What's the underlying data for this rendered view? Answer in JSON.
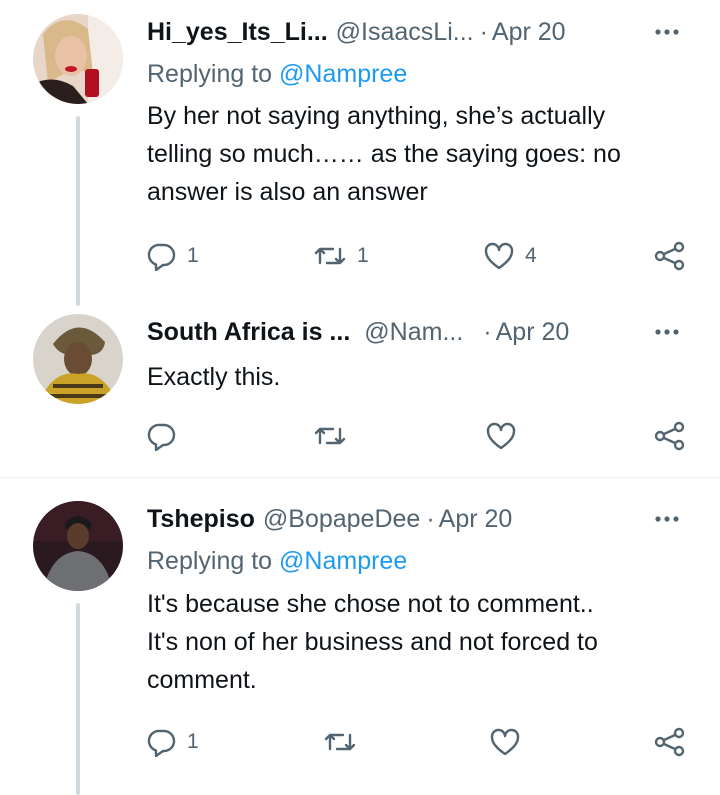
{
  "tweets": [
    {
      "name": "Hi_yes_Its_Li...",
      "handle": "@IsaacsLi...",
      "separator": "·",
      "date": "Apr 20",
      "replying_prefix": "Replying to ",
      "replying_to": "@Nampree",
      "lines": [
        "By her not saying anything, she’s actually",
        "telling so much…… as the saying goes: no",
        "answer is also an answer"
      ],
      "reply_count": "1",
      "retweet_count": "1",
      "like_count": "4",
      "avatar_icon": "profile-photo-woman-red-lips"
    },
    {
      "name": "South Africa is ...",
      "handle": "@Nam...",
      "separator": "·",
      "date": "Apr 20",
      "lines": [
        "Exactly this."
      ],
      "reply_count": "",
      "retweet_count": "",
      "like_count": "",
      "avatar_icon": "profile-photo-headwrap"
    },
    {
      "name": "Tshepiso",
      "handle": "@BopapeDee",
      "separator": "·",
      "date": "Apr 20",
      "replying_prefix": "Replying to ",
      "replying_to": "@Nampree",
      "lines": [
        "It's because she chose not to comment..",
        "It's non of her business and not forced to",
        "comment."
      ],
      "reply_count": "1",
      "retweet_count": "",
      "like_count": "",
      "avatar_icon": "profile-photo-man-beanie"
    }
  ],
  "colors": {
    "text": "#0f1419",
    "secondary": "#536471",
    "link": "#1d9bf0",
    "thread_line": "#cfd9de",
    "divider": "#eff3f4"
  },
  "icons": [
    "reply-icon",
    "retweet-icon",
    "like-icon",
    "share-icon",
    "more-options-icon"
  ]
}
